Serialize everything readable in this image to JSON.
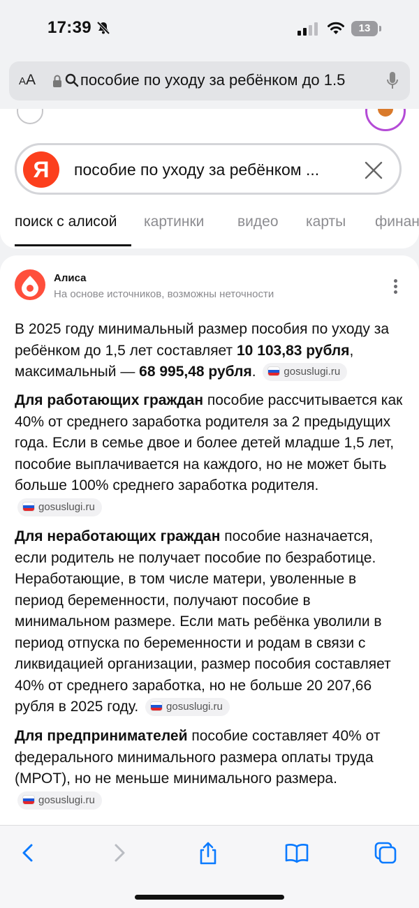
{
  "status_bar": {
    "time": "17:39",
    "battery": "13",
    "icons": [
      "bell-slash-icon",
      "signal-icon",
      "wifi-icon",
      "battery-icon"
    ]
  },
  "address_bar": {
    "aa_small": "A",
    "aa_large": "A",
    "url_text": "пособие по уходу за ребёнком до 1.5",
    "icons": [
      "lock-icon",
      "search-icon",
      "microphone-icon"
    ]
  },
  "search": {
    "logo": "Я",
    "query": "пособие по уходу за ребёнком ...",
    "clear_icon": "close-icon"
  },
  "tabs": [
    {
      "label": "поиск с алисой",
      "active": true
    },
    {
      "label": "картинки"
    },
    {
      "label": "видео"
    },
    {
      "label": "карты"
    },
    {
      "label": "финан"
    }
  ],
  "answer": {
    "author": "Алиса",
    "disclaimer": "На основе источников, возможны неточности",
    "paragraphs": [
      {
        "t1": "В 2025 году минимальный размер пособия по уходу за ребёнком до 1,5 лет составляет ",
        "b1": "10 103,83 рубля",
        "t2": ", максимальный — ",
        "b2": "68 995,48 рубля",
        "t3": ".",
        "source": "gosuslugi.ru"
      },
      {
        "b1": "Для работающих граждан",
        "t1": " пособие рассчитывается как 40% от среднего заработка родителя за 2 предыдущих года. Если в семье двое и более детей младше 1,5 лет, пособие выплачивается на каждого, но не может быть больше 100% среднего заработка родителя.",
        "source": "gosuslugi.ru"
      },
      {
        "b1": "Для неработающих граждан",
        "t1": " пособие назначается, если родитель не получает пособие по безработице. Неработающие, в том числе матери, уволенные в период беременности, получают пособие в минимальном размере. Если мать ребёнка уволили в период отпуска по беременности и родам в связи с ликвидацией организации, размер пособия составляет 40% от среднего заработка, но не больше 20 207,66 рубля в 2025 году.",
        "source": "gosuslugi.ru"
      },
      {
        "b1": "Для предпринимателей",
        "t1": " пособие составляет 40% от федерального минимального размера оплаты труда (МРОТ), но не меньше минимального размера.",
        "source": "gosuslugi.ru"
      }
    ]
  },
  "toolbar": {
    "icons": [
      "back-icon",
      "forward-icon",
      "share-icon",
      "bookmarks-icon",
      "tabs-icon"
    ]
  },
  "colors": {
    "yandex_red": "#fc3f1d",
    "alice": "#ff4f3c",
    "safari_blue": "#0a7aff"
  }
}
